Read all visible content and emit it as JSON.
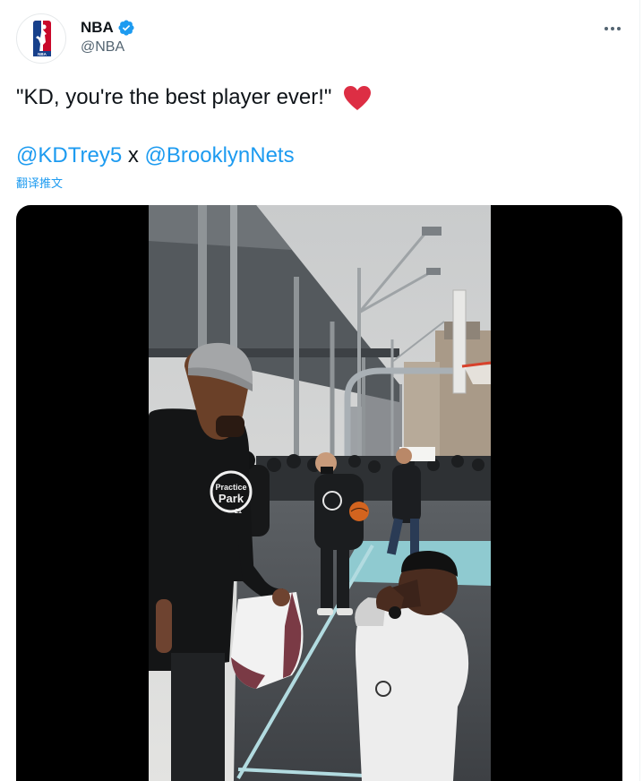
{
  "author": {
    "display_name": "NBA",
    "handle": "@NBA",
    "avatar_icon": "nba-logo-icon",
    "verified_icon": "verified-badge-icon",
    "verified_color": "#1d9bf0"
  },
  "menu_icon": "more-options-icon",
  "tweet": {
    "text": "\"KD, you're the best player ever!\"",
    "emoji": "red-heart",
    "mentions": [
      "@KDTrey5",
      "@BrooklynNets"
    ],
    "mention_separator": "x",
    "translate_label": "翻译推文"
  },
  "media": {
    "type": "video",
    "jersey_text": "Practice in the Park 21"
  },
  "colors": {
    "link": "#1d9bf0",
    "text": "#0f1419",
    "secondary": "#536471",
    "heart": "#e0245e"
  }
}
